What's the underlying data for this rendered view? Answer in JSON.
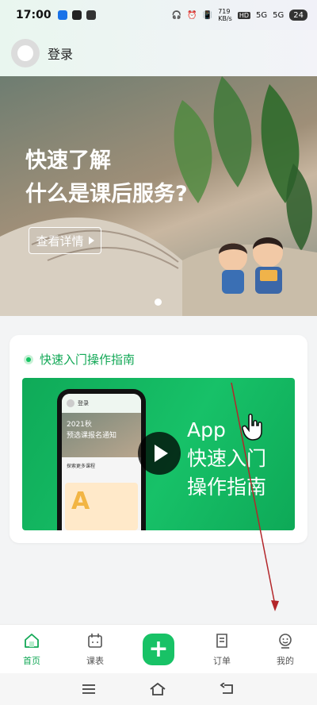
{
  "status_bar": {
    "time": "17:00",
    "net_speed_top": "719",
    "net_speed_unit": "KB/s",
    "network_1": "5G",
    "network_2": "5G",
    "hd_label": "HD",
    "battery": "24"
  },
  "header": {
    "login_label": "登录"
  },
  "banner": {
    "title_line1": "快速了解",
    "title_line2": "什么是课后服务?",
    "button_label": "查看详情"
  },
  "guide": {
    "title": "快速入门操作指南",
    "video": {
      "caption_line1": "App",
      "caption_line2": "快速入门",
      "caption_line3": "操作指南",
      "phone_login": "登录",
      "phone_banner_line1": "2021秋",
      "phone_banner_line2": "预选课报名通知",
      "phone_section": "探索更多课程",
      "phone_card_letter": "A"
    }
  },
  "tabbar": {
    "items": [
      {
        "label": "首页",
        "icon": "home-icon",
        "active": true
      },
      {
        "label": "课表",
        "icon": "calendar-icon",
        "active": false
      },
      {
        "label": "",
        "icon": "plus-icon",
        "active": false
      },
      {
        "label": "订单",
        "icon": "order-icon",
        "active": false
      },
      {
        "label": "我的",
        "icon": "profile-icon",
        "active": false
      }
    ]
  },
  "colors": {
    "accent": "#18c266",
    "accent_text": "#12a856",
    "annotation": "#b3262a"
  }
}
